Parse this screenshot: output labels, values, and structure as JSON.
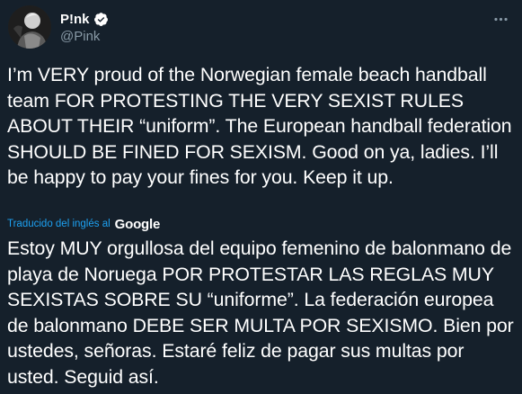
{
  "author": {
    "display_name": "P!nk",
    "handle": "@Pink",
    "verified": true,
    "avatar_icon": "profile-photo"
  },
  "menu": {
    "icon": "more-horizontal-icon"
  },
  "tweet": {
    "text": "I’m VERY proud of the Norwegian female beach handball team FOR PROTESTING THE VERY SEXIST RULES ABOUT THEIR “uniform”. The European handball federation SHOULD BE FINED FOR SEXISM. Good on ya, ladies. I’ll be happy to pay your fines for you. Keep it up."
  },
  "translation": {
    "label": "Traducido del inglés al",
    "provider": "Google",
    "text": "Estoy MUY orgullosa del equipo femenino de balonmano de playa de Noruega POR PROTESTAR LAS REGLAS MUY SEXISTAS SOBRE SU “uniforme”. La federación europea de balonmano DEBE SER MULTA POR SEXISMO. Bien por ustedes, señoras. Estaré feliz de pagar sus multas por usted. Seguid así."
  },
  "colors": {
    "background": "#15202b",
    "text": "#ffffff",
    "secondary_text": "#8899a6",
    "accent": "#1da1f2"
  }
}
